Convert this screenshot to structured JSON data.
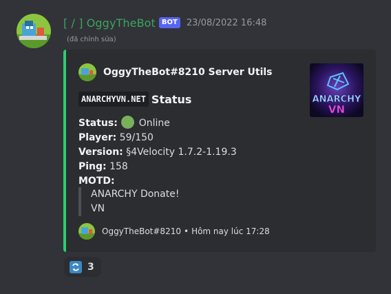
{
  "message": {
    "username": "[ / ] OggyTheBot",
    "bot_tag": "BOT",
    "timestamp": "23/08/2022 16:48",
    "edited": "(đã chỉnh sửa)",
    "avatar_icon": "oggy-cat-avatar-icon"
  },
  "embed": {
    "accent_color": "#2ecc71",
    "author": "OggyTheBot#8210 Server Utils",
    "title_code": "ANARCHYVN.NET",
    "title_text": "Status",
    "thumbnail_text_1": "ANARCHY",
    "thumbnail_text_2": "VN",
    "fields": {
      "status_label": "Status:",
      "status_value": "Online",
      "player_label": "Player:",
      "player_value": "59/150",
      "version_label": "Version:",
      "version_value": "§4Velocity 1.7.2-1.19.3",
      "ping_label": "Ping:",
      "ping_value": "158",
      "motd_label": "MOTD:"
    },
    "motd_lines": [
      "ANARCHY Donate!",
      "VN"
    ],
    "footer": {
      "name": "OggyTheBot#8210",
      "separator": "•",
      "time": "Hôm nay lúc 17:28"
    }
  },
  "reaction": {
    "icon": "repeat-arrows-icon",
    "count": "3"
  }
}
